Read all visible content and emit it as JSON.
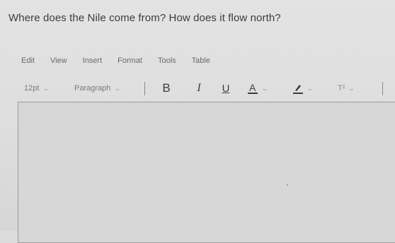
{
  "question": {
    "text": "Where does the Nile come from? How does it flow north?"
  },
  "menubar": {
    "items": [
      "Edit",
      "View",
      "Insert",
      "Format",
      "Tools",
      "Table"
    ]
  },
  "toolbar": {
    "font_size": "12pt",
    "block_format": "Paragraph",
    "bold_label": "B",
    "italic_label": "I",
    "underline_label": "U",
    "text_color_label": "A",
    "superscript_label": "T²"
  },
  "colors": {
    "background": "#dcdcdc",
    "text": "#3c3c3c",
    "muted": "#7a7a7a",
    "editor_border": "#9a9a9a"
  }
}
